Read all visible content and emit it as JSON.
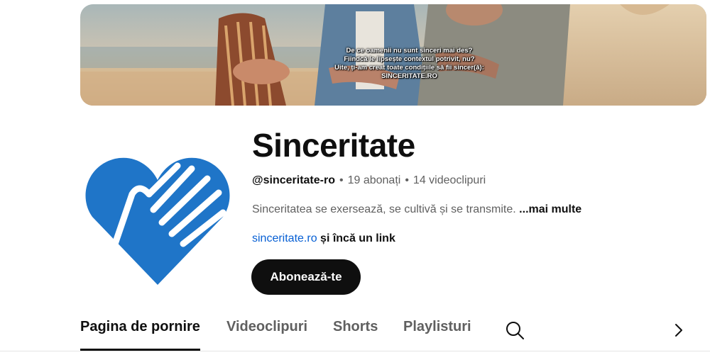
{
  "banner": {
    "lines": [
      "De ce oamenii nu sunt sinceri mai des?",
      "Fiindcă le lipsește contextul potrivit, nu?",
      "Uite, ți-am creat toate condițiile să fii sincer(ă):",
      "SINCERITATE.RO"
    ]
  },
  "channel": {
    "name": "Sinceritate",
    "handle": "@sinceritate-ro",
    "separator": "•",
    "subscribers": "19 abonați",
    "videos": "14 videoclipuri",
    "description": "Sinceritatea se exersează, se cultivă și se transmite. ",
    "more_label": "...mai multe",
    "link_text": "sinceritate.ro",
    "link_extra": "și încă un link",
    "subscribe_label": "Abonează-te"
  },
  "tabs": [
    {
      "label": "Pagina de pornire",
      "active": true
    },
    {
      "label": "Videoclipuri",
      "active": false
    },
    {
      "label": "Shorts",
      "active": false
    },
    {
      "label": "Playlisturi",
      "active": false
    }
  ],
  "icons": {
    "search": "search-icon",
    "next": "chevron-right-icon"
  },
  "colors": {
    "brand_blue": "#1f75c8",
    "link_blue": "#065fd4",
    "subscribe_bg": "#0f0f0f"
  }
}
